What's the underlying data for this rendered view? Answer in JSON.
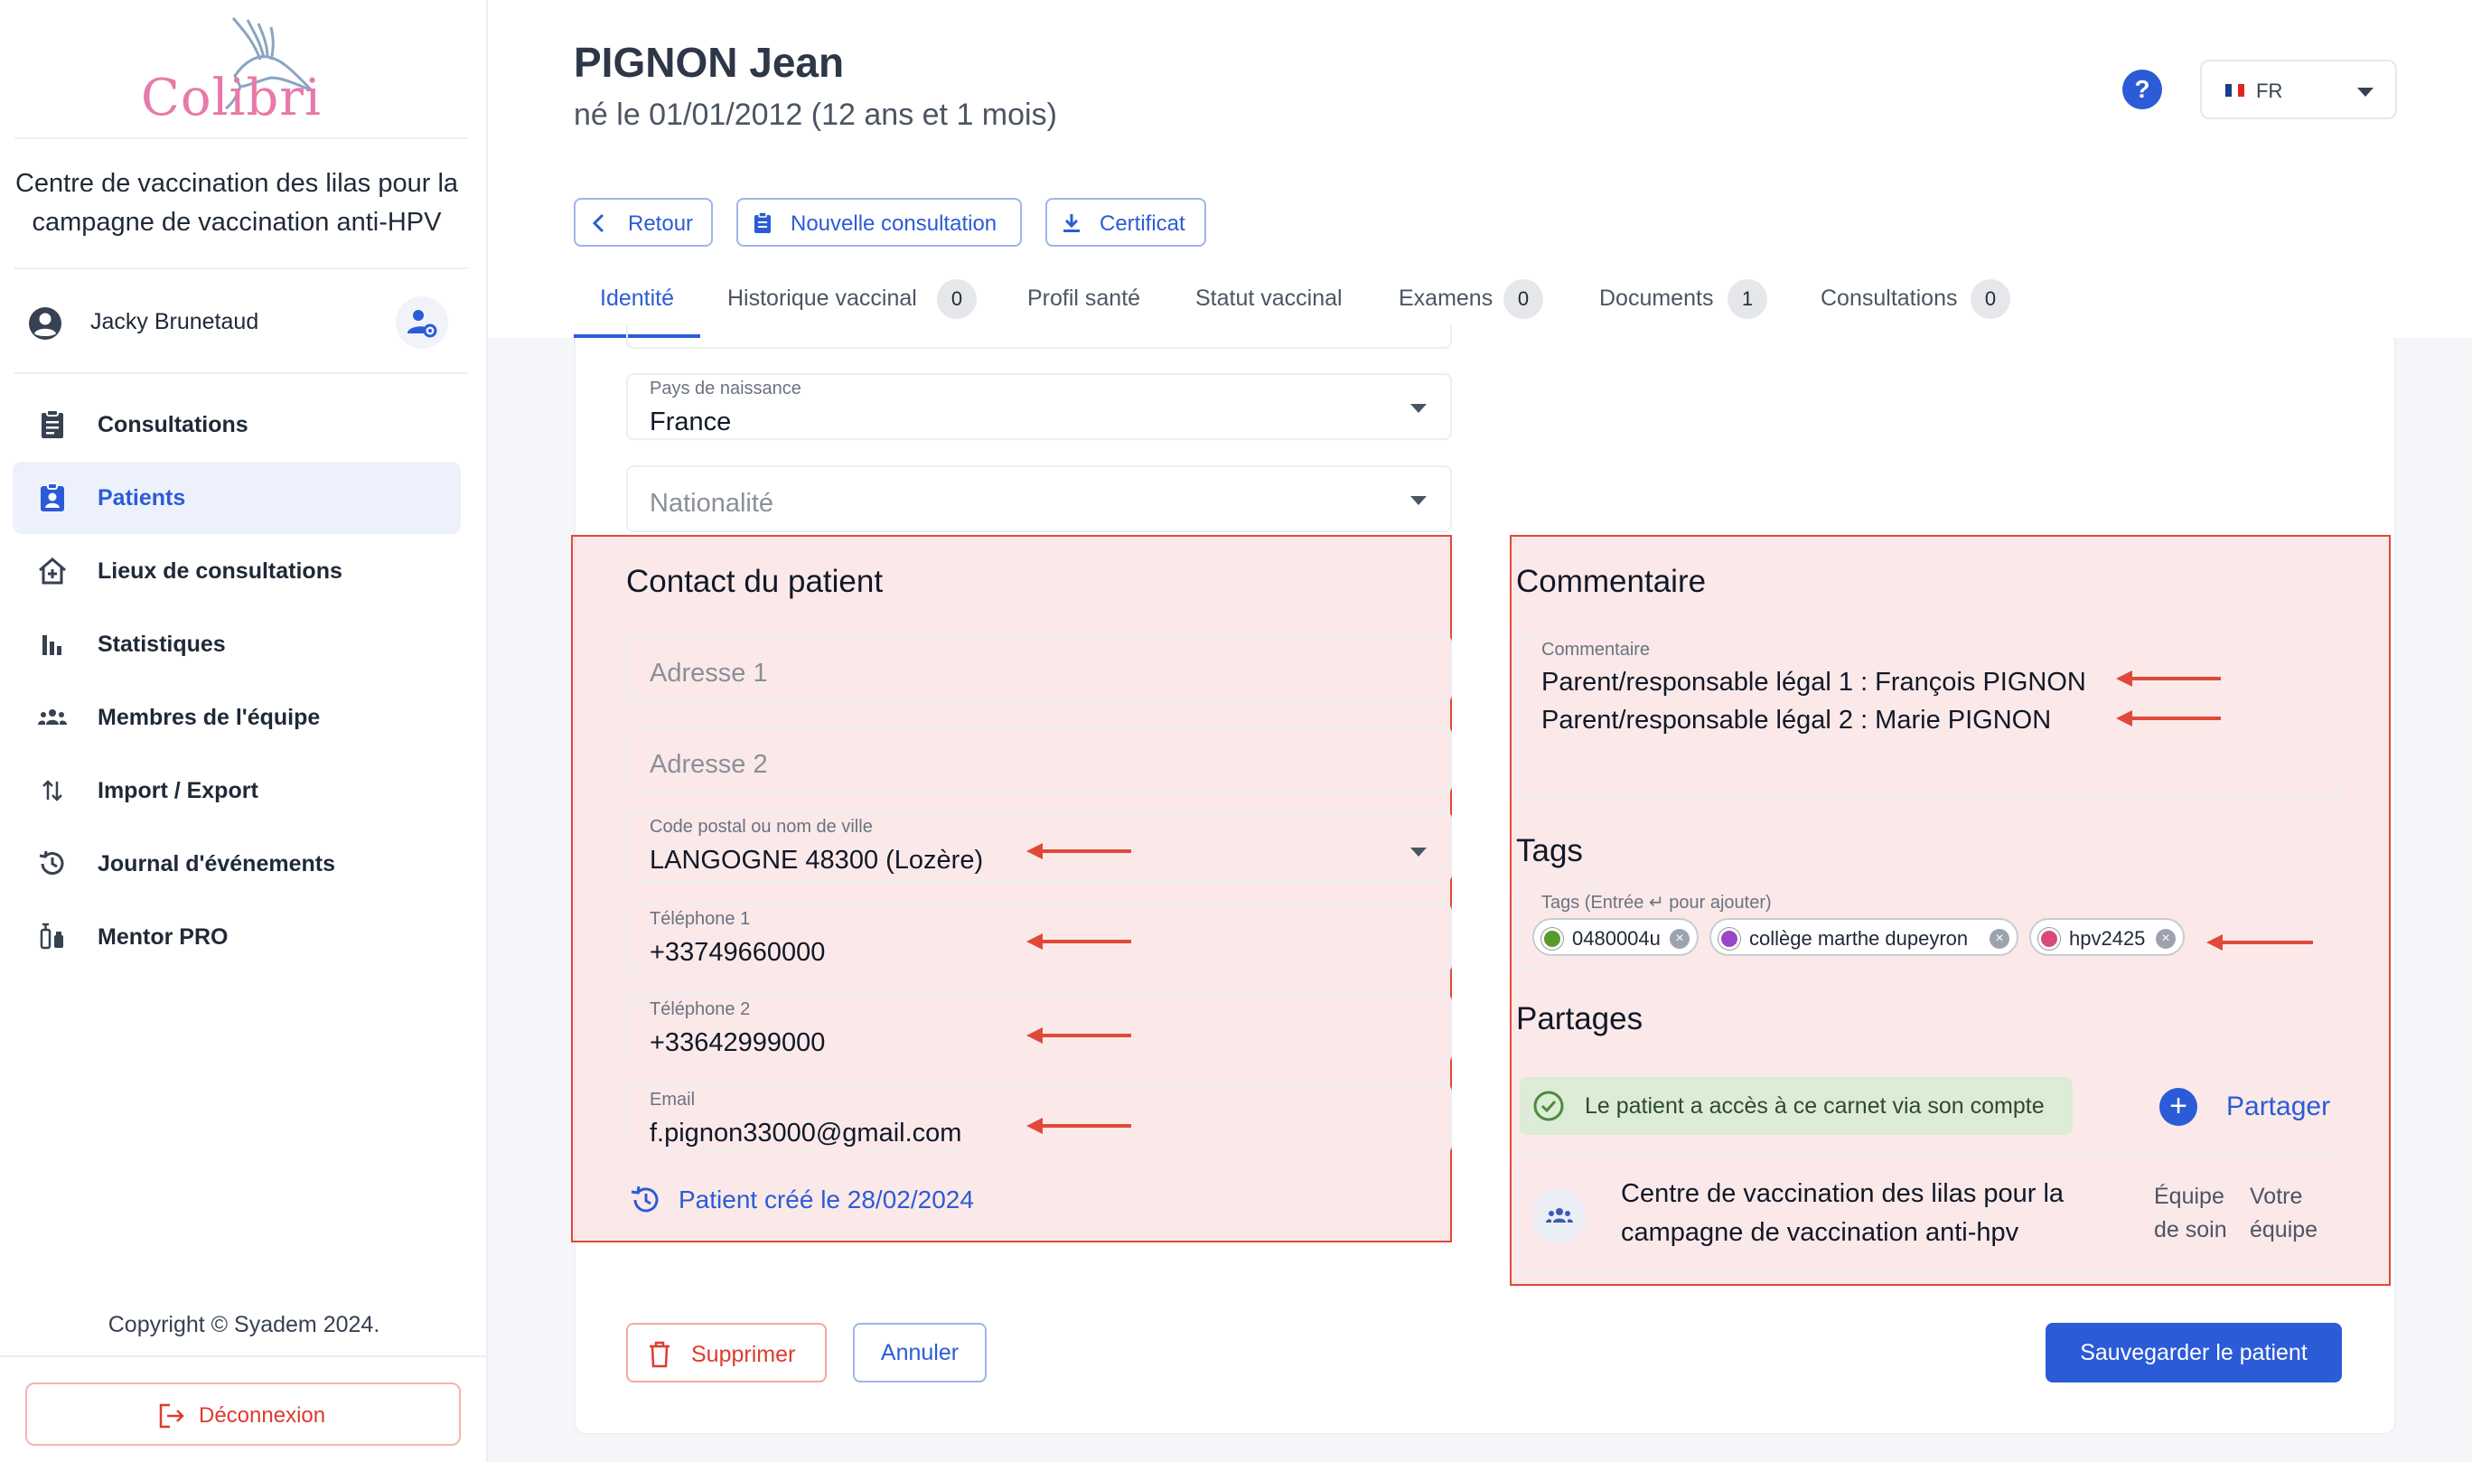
{
  "brand": {
    "logo_text": "Colibri"
  },
  "sidebar": {
    "center_name": "Centre de vaccination des lilas pour la campagne de vaccination anti-HPV",
    "user_name": "Jacky Brunetaud",
    "items": [
      {
        "label": "Consultations",
        "icon": "clipboard-icon",
        "active": false
      },
      {
        "label": "Patients",
        "icon": "patient-badge-icon",
        "active": true
      },
      {
        "label": "Lieux de consultations",
        "icon": "house-plus-icon",
        "active": false
      },
      {
        "label": "Statistiques",
        "icon": "bar-chart-icon",
        "active": false
      },
      {
        "label": "Membres de l'équipe",
        "icon": "team-icon",
        "active": false
      },
      {
        "label": "Import / Export",
        "icon": "swap-vertical-icon",
        "active": false
      },
      {
        "label": "Journal d'événements",
        "icon": "history-icon",
        "active": false
      },
      {
        "label": "Mentor PRO",
        "icon": "vaccine-icon",
        "active": false
      }
    ],
    "copyright": "Copyright © Syadem 2024.",
    "logout_label": "Déconnexion"
  },
  "header": {
    "patient_name": "PIGNON Jean",
    "patient_dob": "né le 01/01/2012 (12 ans et 1 mois)",
    "language": "FR",
    "buttons": {
      "back": "Retour",
      "new_consultation": "Nouvelle consultation",
      "certificate": "Certificat"
    },
    "tabs": [
      {
        "label": "Identité",
        "count": null
      },
      {
        "label": "Historique vaccinal",
        "count": "0"
      },
      {
        "label": "Profil santé",
        "count": null
      },
      {
        "label": "Statut vaccinal",
        "count": null
      },
      {
        "label": "Examens",
        "count": "0"
      },
      {
        "label": "Documents",
        "count": "1"
      },
      {
        "label": "Consultations",
        "count": "0"
      }
    ]
  },
  "identity": {
    "birth_country": {
      "label": "Pays de naissance",
      "value": "France"
    },
    "nationality": {
      "placeholder": "Nationalité"
    }
  },
  "contact": {
    "title": "Contact du patient",
    "address1": {
      "placeholder": "Adresse 1"
    },
    "address2": {
      "placeholder": "Adresse 2"
    },
    "city": {
      "label": "Code postal ou nom de ville",
      "value": "LANGOGNE 48300 (Lozère)"
    },
    "phone1": {
      "label": "Téléphone 1",
      "value": "+33749660000"
    },
    "phone2": {
      "label": "Téléphone 2",
      "value": "+33642999000"
    },
    "email": {
      "label": "Email",
      "value": "f.pignon33000@gmail.com"
    },
    "created": "Patient créé le 28/02/2024"
  },
  "comment": {
    "title": "Commentaire",
    "label": "Commentaire",
    "lines": [
      "Parent/responsable légal 1 : François PIGNON",
      "Parent/responsable légal 2 : Marie PIGNON"
    ]
  },
  "tags": {
    "title": "Tags",
    "label": "Tags (Entrée ↵ pour ajouter)",
    "items": [
      {
        "label": "0480004u",
        "color": "#5a9a2c"
      },
      {
        "label": "collège marthe dupeyron",
        "color": "#9b45c9"
      },
      {
        "label": "hpv2425",
        "color": "#d94a7a"
      }
    ]
  },
  "shares": {
    "title": "Partages",
    "access_text": "Le patient a accès à ce carnet via son compte",
    "share_label": "Partager",
    "entry": {
      "name": "Centre de vaccination des lilas pour la campagne de vaccination anti-hpv",
      "col1": [
        "Équipe",
        "de soin"
      ],
      "col2": [
        "Votre",
        "équipe"
      ]
    }
  },
  "actions": {
    "delete": "Supprimer",
    "cancel": "Annuler",
    "save": "Sauvegarder le patient"
  },
  "colors": {
    "accent": "#2b5bd7",
    "danger": "#dc3b2f",
    "highlight_border": "#e0493a"
  }
}
